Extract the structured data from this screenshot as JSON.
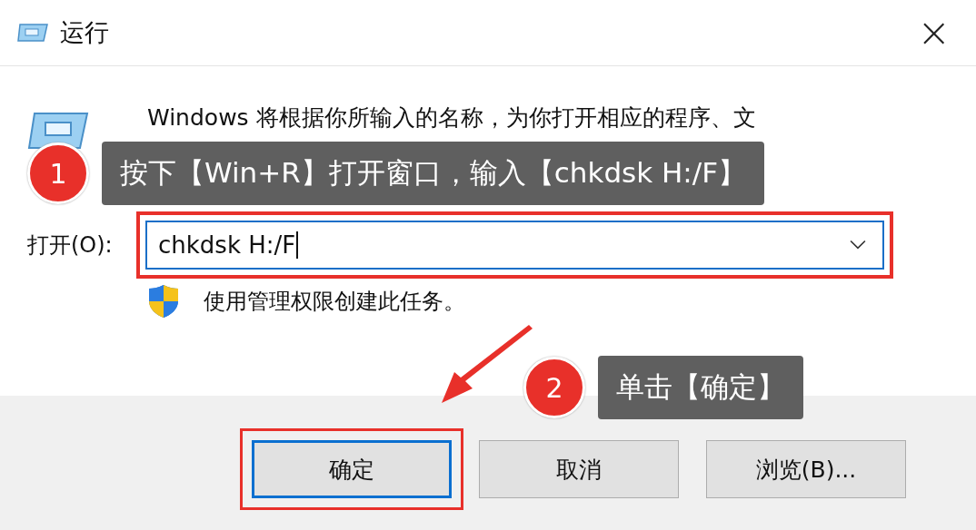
{
  "window": {
    "title": "运行",
    "close": "×"
  },
  "description": "Windows 将根据你所输入的名称，为你打开相应的程序、文",
  "open_field": {
    "label": "打开(O):",
    "value": "chkdsk H:/F",
    "highlighted": true
  },
  "admin_note": "使用管理权限创建此任务。",
  "buttons": [
    {
      "label": "确定",
      "default": true,
      "highlighted": true
    },
    {
      "label": "取消",
      "default": false,
      "highlighted": false
    },
    {
      "label": "浏览(B)...",
      "default": false,
      "highlighted": false
    }
  ],
  "callouts": [
    {
      "number": "1",
      "text": "按下【Win+R】打开窗口，输入【chkdsk H:/F】"
    },
    {
      "number": "2",
      "text": "单击【确定】"
    }
  ]
}
